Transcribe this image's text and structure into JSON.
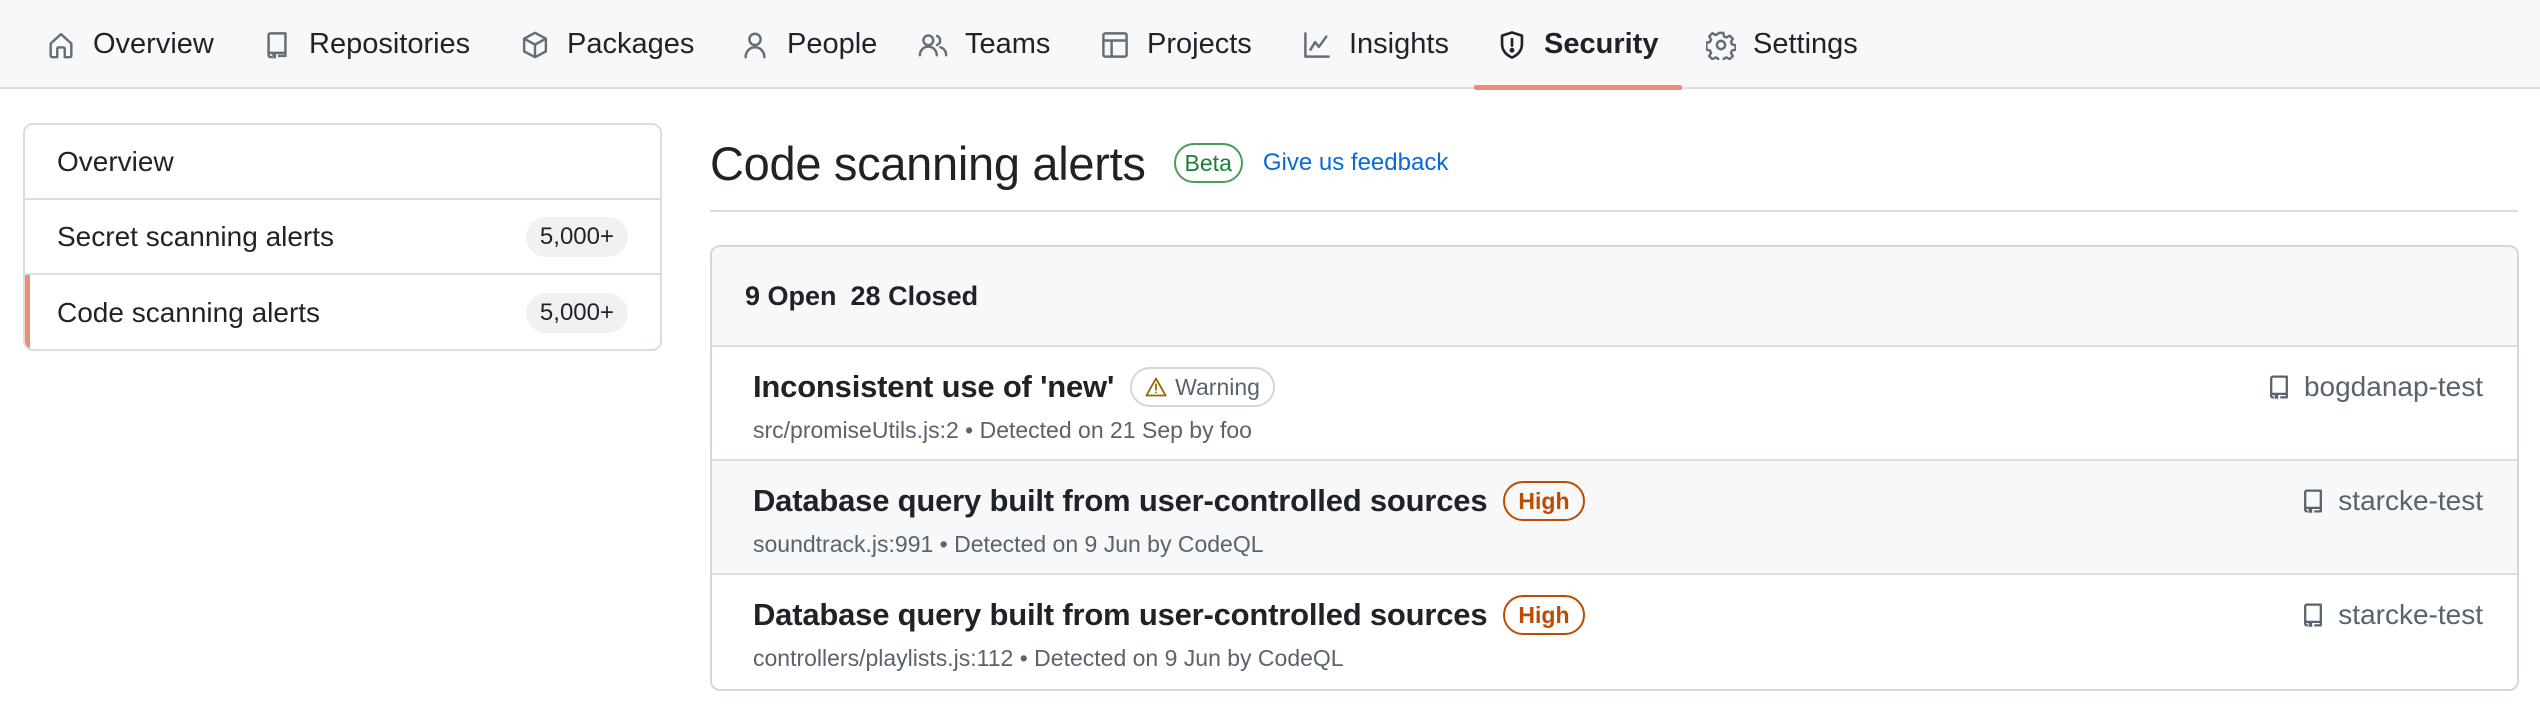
{
  "nav": {
    "items": [
      {
        "label": "Overview",
        "icon": "home-icon"
      },
      {
        "label": "Repositories",
        "icon": "repo-icon"
      },
      {
        "label": "Packages",
        "icon": "package-icon"
      },
      {
        "label": "People",
        "icon": "person-icon"
      },
      {
        "label": "Teams",
        "icon": "people-icon"
      },
      {
        "label": "Projects",
        "icon": "table-icon"
      },
      {
        "label": "Insights",
        "icon": "graph-icon"
      },
      {
        "label": "Security",
        "icon": "shield-icon",
        "active": true
      },
      {
        "label": "Settings",
        "icon": "gear-icon"
      }
    ],
    "accent_color": "#ec8e74"
  },
  "sidebar": {
    "items": [
      {
        "label": "Overview"
      },
      {
        "label": "Secret scanning alerts",
        "count": "5,000+"
      },
      {
        "label": "Code scanning alerts",
        "count": "5,000+",
        "active": true
      }
    ]
  },
  "main": {
    "title": "Code scanning alerts",
    "beta_label": "Beta",
    "feedback_link": "Give us feedback",
    "tabs": {
      "open": "9 Open",
      "closed": "28 Closed"
    },
    "alerts": [
      {
        "title": "Inconsistent use of 'new'",
        "severity": "Warning",
        "meta": "src/promiseUtils.js:2 • Detected on 21 Sep by foo",
        "repo": "bogdanap-test"
      },
      {
        "title": "Database query built from user-controlled sources",
        "severity": "High",
        "meta": "soundtrack.js:991 • Detected on 9 Jun by CodeQL",
        "repo": "starcke-test"
      },
      {
        "title": "Database query built from user-controlled sources",
        "severity": "High",
        "meta": "controllers/playlists.js:112 • Detected on 9 Jun by CodeQL",
        "repo": "starcke-test"
      }
    ],
    "colors": {
      "beta": "#1a7f37",
      "high": "#bc4c00",
      "warning_icon": "#9a6700",
      "link": "#0969da"
    }
  }
}
